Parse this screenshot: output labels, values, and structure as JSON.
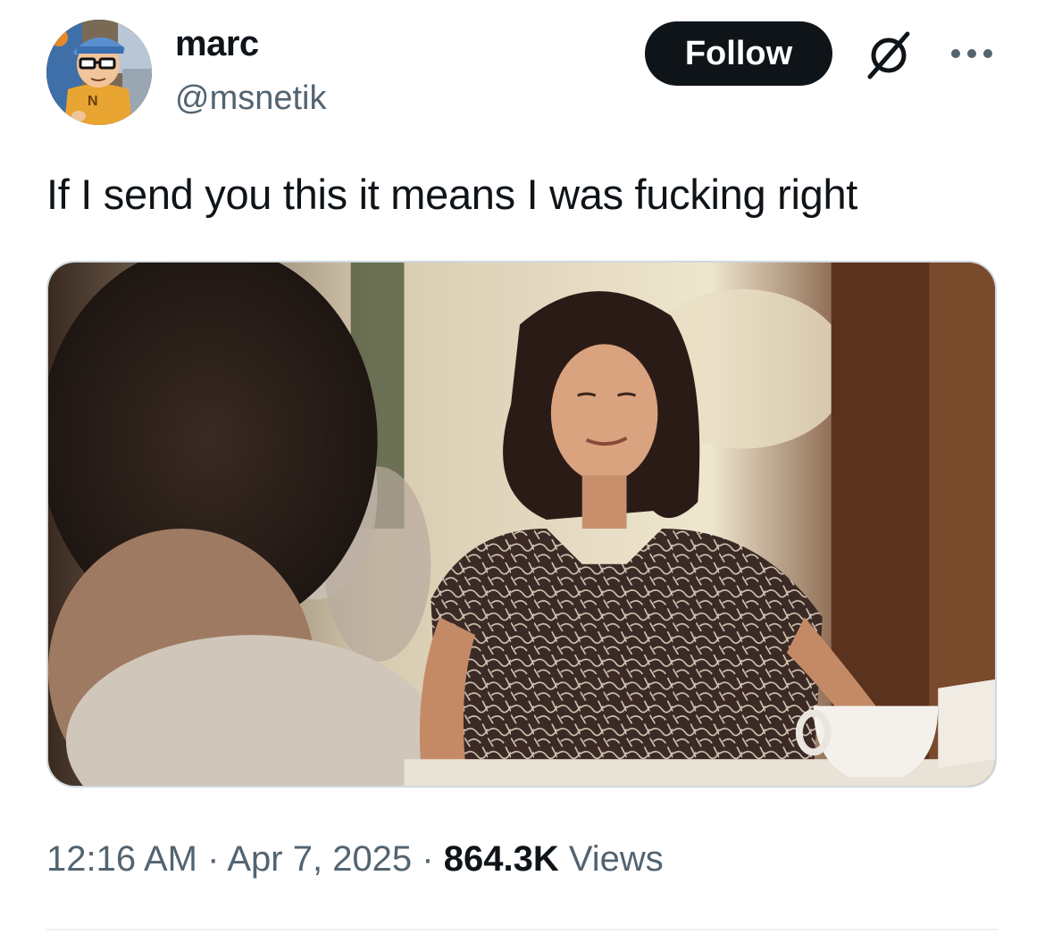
{
  "author": {
    "name": "marc",
    "handle": "@msnetik",
    "avatar_icon": "cartoon-avatar"
  },
  "actions": {
    "follow_label": "Follow",
    "grok_icon": "grok-icon",
    "more_icon": "more-options-icon"
  },
  "tweet": {
    "text": "If I send you this it means I was fucking right"
  },
  "media": {
    "type": "image",
    "alt_description_icon": "video-still-image"
  },
  "meta": {
    "time": "12:16 AM",
    "separator": " · ",
    "date": "Apr 7, 2025",
    "views_count": "864.3K",
    "views_label": " Views"
  },
  "colors": {
    "text_primary": "#0f1419",
    "text_secondary": "#536471",
    "button_bg": "#0f1419",
    "border": "#cfd9de"
  }
}
